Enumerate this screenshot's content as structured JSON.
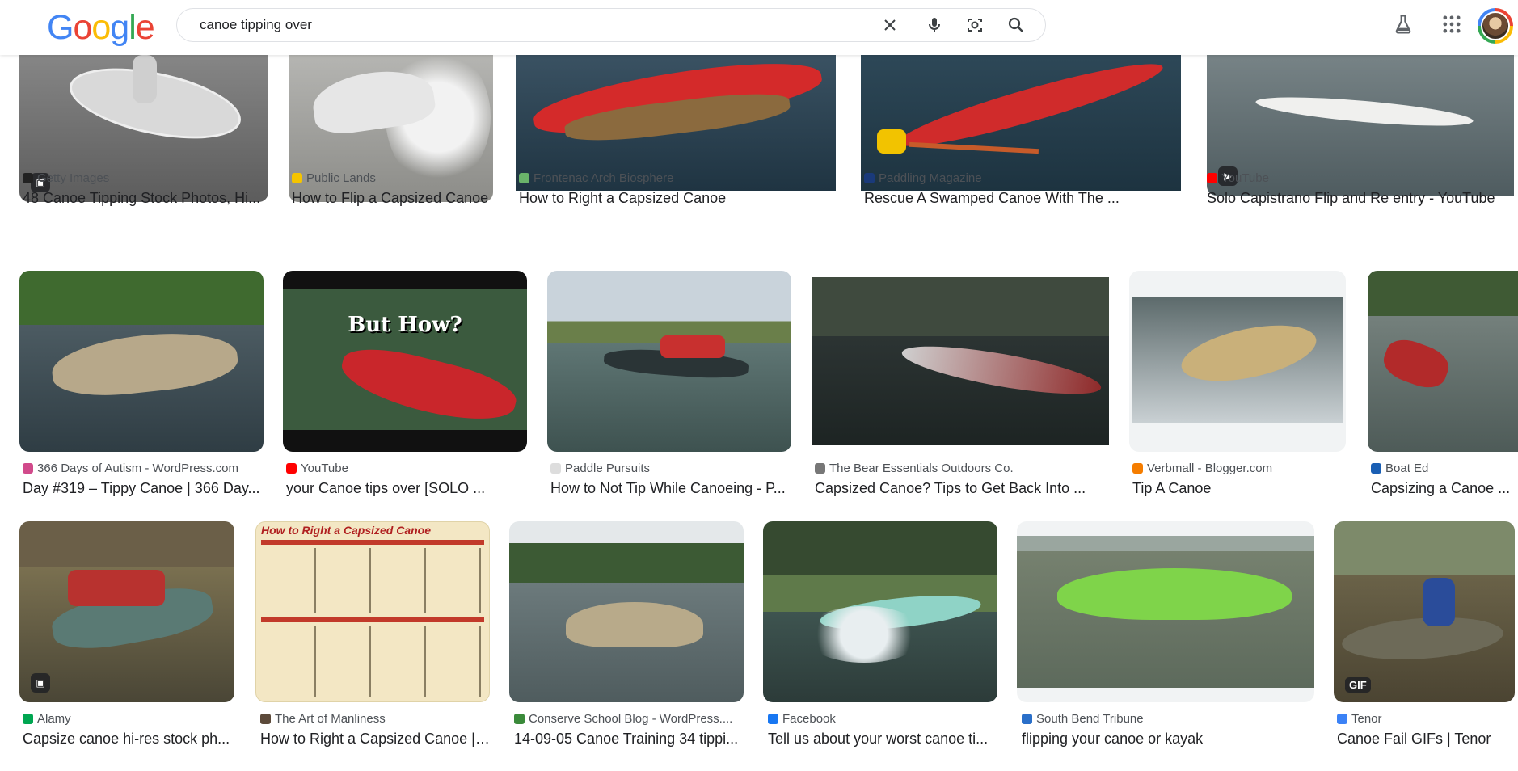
{
  "header": {
    "logo": "Google",
    "search": {
      "value": "canoe tipping over"
    }
  },
  "results": [
    {
      "source": "Getty Images",
      "title": "48 Canoe Tipping Stock Photos, Hi...",
      "fav": "#222222"
    },
    {
      "source": "Public Lands",
      "title": "How to Flip a Capsized Canoe",
      "fav": "#f5c400"
    },
    {
      "source": "Frontenac Arch Biosphere",
      "title": "How to Right a Capsized Canoe",
      "fav": "#6ab36a"
    },
    {
      "source": "Paddling Magazine",
      "title": "Rescue A Swamped Canoe With The ...",
      "fav": "#1a3a7a"
    },
    {
      "source": "YouTube",
      "title": "Solo Capistrano Flip and Re entry - YouTube",
      "fav": "#ff0000"
    },
    {
      "source": "366 Days of Autism - WordPress.com",
      "title": "Day #319 – Tippy Canoe | 366 Day...",
      "fav": "#d14a8b"
    },
    {
      "source": "YouTube",
      "title": "your Canoe tips over [SOLO ...",
      "fav": "#ff0000"
    },
    {
      "source": "Paddle Pursuits",
      "title": "How to Not Tip While Canoeing - P...",
      "fav": "#dddddd"
    },
    {
      "source": "The Bear Essentials Outdoors Co.",
      "title": "Capsized Canoe? Tips to Get Back Into ...",
      "fav": "#777777"
    },
    {
      "source": "Verbmall - Blogger.com",
      "title": "Tip A Canoe",
      "fav": "#f57d00"
    },
    {
      "source": "Boat Ed",
      "title": "Capsizing a Canoe ...",
      "fav": "#1a5fb4"
    },
    {
      "source": "Alamy",
      "title": "Capsize canoe hi-res stock ph...",
      "fav": "#00a651"
    },
    {
      "source": "The Art of Manliness",
      "title": "How to Right a Capsized Canoe | ...",
      "fav": "#5c4a3a"
    },
    {
      "source": "Conserve School Blog - WordPress....",
      "title": "14-09-05 Canoe Training 34 tippi...",
      "fav": "#3a8a3a"
    },
    {
      "source": "Facebook",
      "title": "Tell us about your worst canoe ti...",
      "fav": "#1877f2"
    },
    {
      "source": "South Bend Tribune",
      "title": "flipping your canoe or kayak",
      "fav": "#2a6fc9"
    },
    {
      "source": "Tenor",
      "title": "Canoe Fail GIFs | Tenor",
      "fav": "#3b82f6"
    }
  ],
  "badges": {
    "gif": "GIF"
  },
  "thumb_text": {
    "but_how": "But How?",
    "aom_title": "How to Right a Capsized Canoe"
  }
}
